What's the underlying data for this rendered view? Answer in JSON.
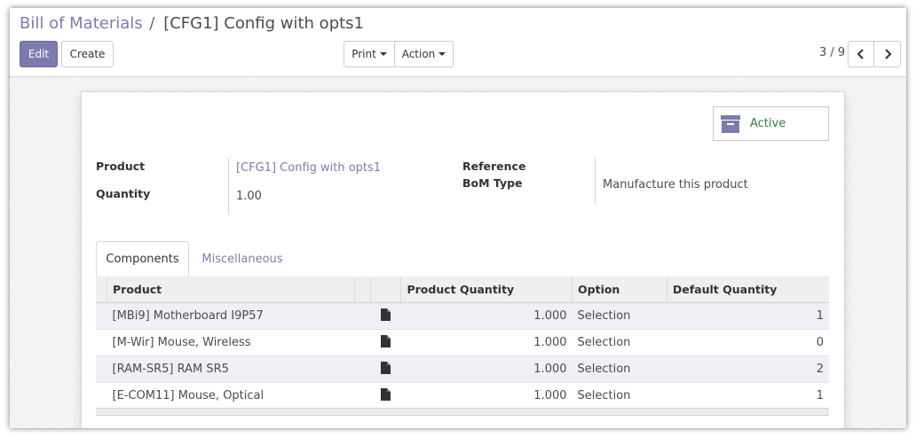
{
  "breadcrumb": {
    "parent": "Bill of Materials",
    "separator": "/",
    "current": "[CFG1] Config with opts1"
  },
  "toolbar": {
    "edit_label": "Edit",
    "create_label": "Create",
    "print_label": "Print",
    "action_label": "Action"
  },
  "pager": {
    "value": "3 / 9"
  },
  "active_button": {
    "label": "Active",
    "icon": "archive-icon"
  },
  "form": {
    "product_label": "Product",
    "product_value": "[CFG1] Config with opts1",
    "quantity_label": "Quantity",
    "quantity_value": "1.00",
    "reference_label": "Reference",
    "reference_value": "",
    "bom_type_label": "BoM Type",
    "bom_type_value": "Manufacture this product"
  },
  "tabs": [
    "Components",
    "Miscellaneous"
  ],
  "table": {
    "columns": [
      "Product",
      "",
      "Product Quantity",
      "Option",
      "Default Quantity"
    ],
    "rows": [
      {
        "product": "[MBi9] Motherboard I9P57",
        "qty": "1.000",
        "option": "Selection",
        "default_qty": "1"
      },
      {
        "product": "[M-Wir] Mouse, Wireless",
        "qty": "1.000",
        "option": "Selection",
        "default_qty": "0"
      },
      {
        "product": "[RAM-SR5] RAM SR5",
        "qty": "1.000",
        "option": "Selection",
        "default_qty": "2"
      },
      {
        "product": "[E-COM11] Mouse, Optical",
        "qty": "1.000",
        "option": "Selection",
        "default_qty": "1"
      }
    ]
  },
  "colors": {
    "accent": "#7c7bad",
    "active_green": "#2f7d3a"
  }
}
